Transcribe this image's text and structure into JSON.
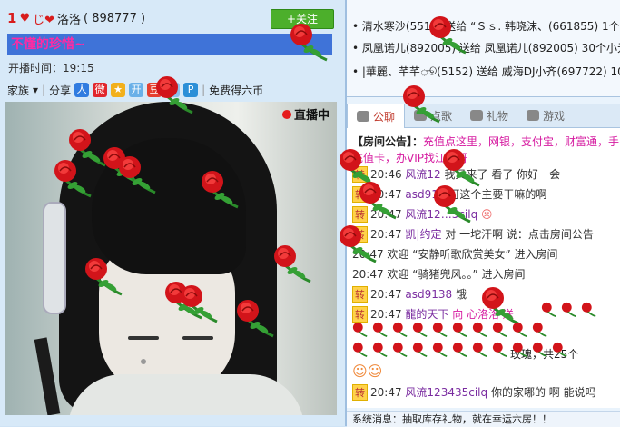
{
  "left": {
    "level": "1",
    "username": "洛洛",
    "room_id": "( 898777 )",
    "follow_label": "+关注",
    "banner": "不懂的珍惜~",
    "open_time": "开播时间：19:15",
    "tools": {
      "family": "家族",
      "share": "分享",
      "free_coin": "免费得六币"
    },
    "live_label": "直播中"
  },
  "gifts": [
    "• 清水寒沙(551… 送给 “Ｓｓ. 韩晓沫、(661855) 1个",
    "• 凤凰诺儿(892005) 送给 凤凰诺儿(892005) 30个小元",
    "• |華麗、芊芊ூ(5152) 送给 威海DJ小齐(697722) 100个"
  ],
  "tabs": [
    "公聊",
    "点歌",
    "礼物",
    "游戏"
  ],
  "chat": {
    "notice_label": "【房间公告】：",
    "notice_text": "充值点这里，网银，支付宝，财富通，手",
    "notice_text2": "充值卡，办VIP找",
    "notice_text3": "江湖哥",
    "lines": [
      {
        "time": "20:46",
        "name": "风流12",
        "text": "我又来了 看了 你好一会"
      },
      {
        "time": "20:47",
        "name": "asd913",
        "text": "可这个主要干嘛的啊"
      },
      {
        "time": "20:47",
        "name": "风流12…5cilq",
        "text": ""
      },
      {
        "time": "20:47",
        "name": "凯|约定",
        "text": "对 一坨汗啊 说：点击房间公告"
      },
      {
        "time": "20:47",
        "name": "",
        "text": "欢迎 “安静听歌欣赏美女” 进入房间"
      },
      {
        "time": "20:47",
        "name": "",
        "text": "欢迎 “骑猪兜风。。” 进入房间"
      },
      {
        "time": "20:47",
        "name": "asd9138",
        "text": "饿"
      },
      {
        "time": "20:47",
        "name": "龍的天下",
        "text": "向 心洛洛 送"
      },
      {
        "time": "20:47",
        "name": "风流123435cilq",
        "text": "你的家哪的 啊 能说吗"
      }
    ],
    "gift_summary": "玫瑰，共25个"
  },
  "system_msg": "系统消息：抽取库存礼物，就在幸运六房！！"
}
